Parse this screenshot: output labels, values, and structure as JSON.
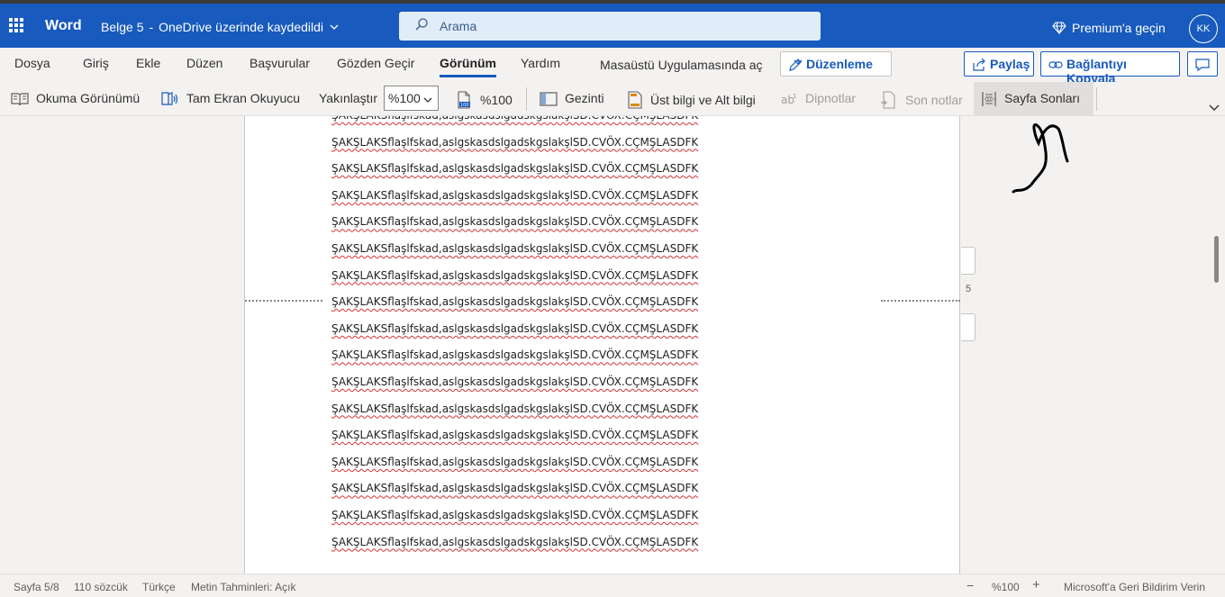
{
  "topbar": {
    "app_name": "Word",
    "doc_name": "Belge 5",
    "separator": "-",
    "save_status": "OneDrive üzerinde kaydedildi",
    "search_placeholder": "Arama",
    "premium_label": "Premium'a geçin",
    "user_initials": "KK"
  },
  "tabs": {
    "items": [
      "Dosya",
      "Giriş",
      "Ekle",
      "Düzen",
      "Başvurular",
      "Gözden Geçir",
      "Görünüm",
      "Yardım"
    ],
    "active": "Görünüm",
    "desktop_app_label": "Masaüstü Uygulamasında aç",
    "editing_label": "Düzenleme",
    "share_label": "Paylaş",
    "copy_link_label": "Bağlantıyı Kopyala"
  },
  "ribbon": {
    "reading_view": "Okuma Görünümü",
    "immersive_reader": "Tam Ekran Okuyucu",
    "zoom_label": "Yakınlaştır",
    "zoom_value": "%100",
    "zoom_100": "%100",
    "navigation": "Gezinti",
    "header_footer": "Üst bilgi ve Alt bilgi",
    "footnotes": "Dipnotlar",
    "endnotes": "Son notlar",
    "page_breaks": "Sayfa Sonları"
  },
  "document": {
    "line_text": "ŞAKŞLAKSflaşlfskad,aslgskasdslgadskgslakşlSD.CVÖX.CÇMŞLASDFK",
    "line_count": 17,
    "page_number_marker": "5"
  },
  "statusbar": {
    "page": "Sayfa 5/8",
    "words": "110 sözcük",
    "language": "Türkçe",
    "text_predictions": "Metin Tahminleri: Açık",
    "zoom_out": "−",
    "zoom_level": "%100",
    "zoom_in": "+",
    "feedback": "Microsoft'a Geri Bildirim Verin"
  },
  "colors": {
    "brand": "#185abd",
    "spellcheck": "#d13438"
  }
}
